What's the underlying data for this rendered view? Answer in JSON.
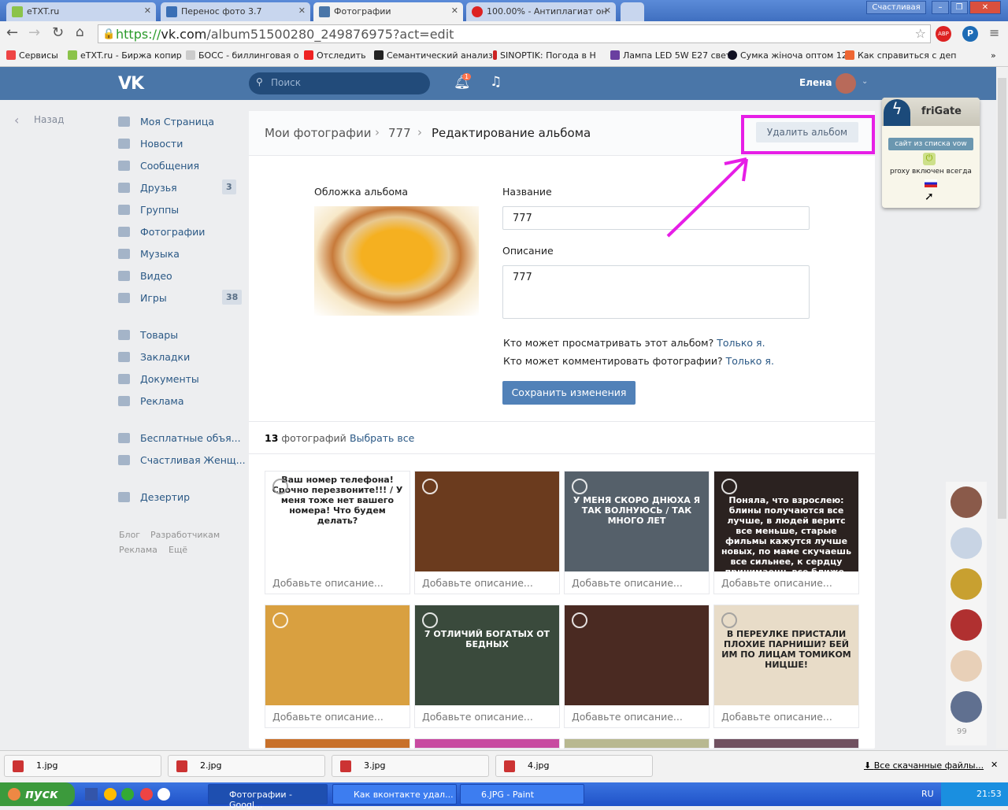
{
  "browser": {
    "tabs": [
      {
        "label": "eTXT.ru"
      },
      {
        "label": "Перенос фото 3.7"
      },
      {
        "label": "Фотографии"
      },
      {
        "label": "100.00% - Антиплагиат он"
      }
    ],
    "user_label": "Счастливая",
    "url_scheme": "https://",
    "url_host": "vk.com",
    "url_path": "/album51500280_249876975?act=edit",
    "bookmarks": [
      "Сервисы",
      "eTXT.ru - Биржа копир",
      "БОСС - биллинговая о",
      "Отследить",
      "Семантический анализ",
      "SINOPTIK: Погода в Н",
      "Лампа LED 5W E27 свет",
      "Сумка жіноча оптом 12",
      "Как справиться с деп"
    ],
    "extensions": [
      "ABP",
      "P"
    ]
  },
  "vk_header": {
    "logo": "VK",
    "search_placeholder": "Поиск",
    "notif_count": "1",
    "user_name": "Елена"
  },
  "back_label": "Назад",
  "sidebar": {
    "items": [
      {
        "label": "Моя Страница"
      },
      {
        "label": "Новости"
      },
      {
        "label": "Сообщения"
      },
      {
        "label": "Друзья",
        "badge": "3"
      },
      {
        "label": "Группы"
      },
      {
        "label": "Фотографии"
      },
      {
        "label": "Музыка"
      },
      {
        "label": "Видео"
      },
      {
        "label": "Игры",
        "badge": "38"
      },
      {
        "label": "Товары"
      },
      {
        "label": "Закладки"
      },
      {
        "label": "Документы"
      },
      {
        "label": "Реклама"
      },
      {
        "label": "Бесплатные объя..."
      },
      {
        "label": "Счастливая Женщ..."
      },
      {
        "label": "Дезертир"
      }
    ],
    "footer": [
      "Блог",
      "Разработчикам",
      "Реклама",
      "Ещё"
    ]
  },
  "breadcrumb": [
    "Мои фотографии",
    "777",
    "Редактирование альбома"
  ],
  "delete_album_label": "Удалить альбом",
  "form": {
    "cover_label": "Обложка альбома",
    "name_label": "Название",
    "name_value": "777",
    "desc_label": "Описание",
    "desc_value": "777",
    "view_q": "Кто может просматривать этот альбом?",
    "view_a": "Только я.",
    "comment_q": "Кто может комментировать фотографии?",
    "comment_a": "Только я.",
    "save_label": "Сохранить изменения"
  },
  "photos": {
    "count_num": "13",
    "count_label": "фотографий",
    "select_all": "Выбрать все",
    "items": [
      {
        "caption": "Добавьте описание...",
        "text": "Ваш номер телефона! Срочно перезвоните!!! / У меня тоже нет вашего номера! Что будем делать?",
        "color": "#ffffff"
      },
      {
        "caption": "Добавьте описание...",
        "text": "",
        "color": "#6b3b1e"
      },
      {
        "caption": "Добавьте описание...",
        "text": "У МЕНЯ СКОРО ДНЮХА Я ТАК ВОЛНУЮСЬ / ТАК МНОГО ЛЕТ",
        "color": "#55606a"
      },
      {
        "caption": "Добавьте описание...",
        "text": "Поняла, что взрослею: блины получаются все лучше, в людей веритс все меньше, старые фильмы кажутся лучше новых, по маме скучаешь все сильнее, к сердцу принимаешь все ближе, шапку надеваешь всё чаще.",
        "color": "#2b2220"
      },
      {
        "caption": "Добавьте описание...",
        "text": "",
        "color": "#d9a040"
      },
      {
        "caption": "Добавьте описание...",
        "text": "7 ОТЛИЧИЙ БОГАТЫХ ОТ БЕДНЫХ",
        "color": "#3a4a3c"
      },
      {
        "caption": "Добавьте описание...",
        "text": "",
        "color": "#4a2a22"
      },
      {
        "caption": "Добавьте описание...",
        "text": "В ПЕРЕУЛКЕ ПРИСТАЛИ ПЛОХИЕ ПАРНИШИ? БЕЙ ИМ ПО ЛИЦАМ ТОМИКОМ НИЦШЕ!",
        "color": "#e8dcc8"
      }
    ]
  },
  "frigate": {
    "title": "friGate",
    "status": "сайт из списка vow",
    "proxy": "proxy включен всегда"
  },
  "right_rail": {
    "online_count": "99"
  },
  "downloads": {
    "items": [
      "1.jpg",
      "2.jpg",
      "3.jpg",
      "4.jpg"
    ],
    "all_label": "Все скачанные файлы..."
  },
  "taskbar": {
    "start": "пуск",
    "windows": [
      "Фотографии - Googl...",
      "Как вконтакте удал...",
      "6.JPG - Paint"
    ],
    "lang": "RU",
    "time": "21:53"
  },
  "colors": {
    "vk_blue": "#4a76a8",
    "highlight": "#e61ee6"
  }
}
